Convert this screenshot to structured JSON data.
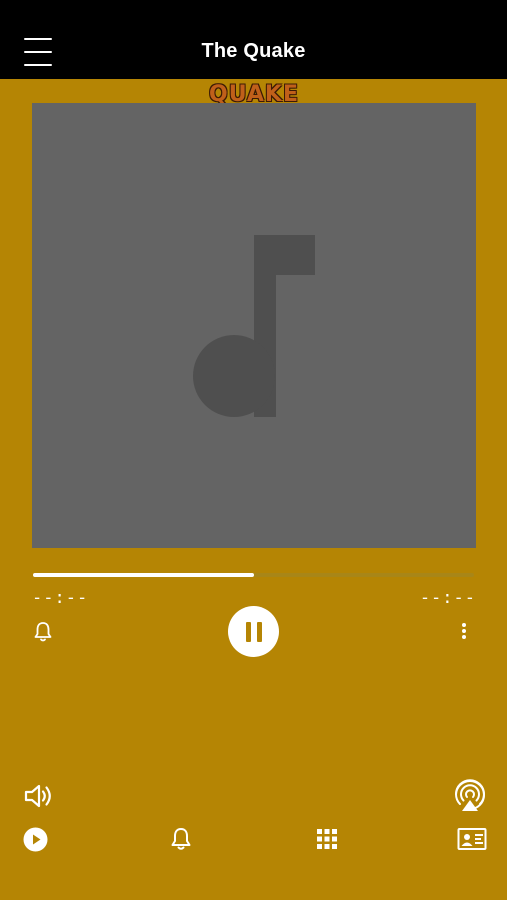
{
  "header": {
    "title": "The Quake",
    "menu_icon": "hamburger-menu-icon"
  },
  "logo": {
    "text": "QUAKE"
  },
  "artwork": {
    "placeholder_icon": "music-note-icon"
  },
  "player": {
    "progress": 0.5,
    "elapsed_time": "--:--",
    "remaining_time": "--:--",
    "play_state": "playing"
  },
  "bottom_bar": {
    "icons": [
      "volume-icon",
      "airplay-icon",
      "play-circle-icon",
      "bell-icon",
      "grid-icon",
      "contact-card-icon"
    ]
  },
  "colors": {
    "background": "#b58504",
    "header": "#000000",
    "artwork": "#646464",
    "note": "#4f4f4f",
    "accent": "#ffffff"
  }
}
